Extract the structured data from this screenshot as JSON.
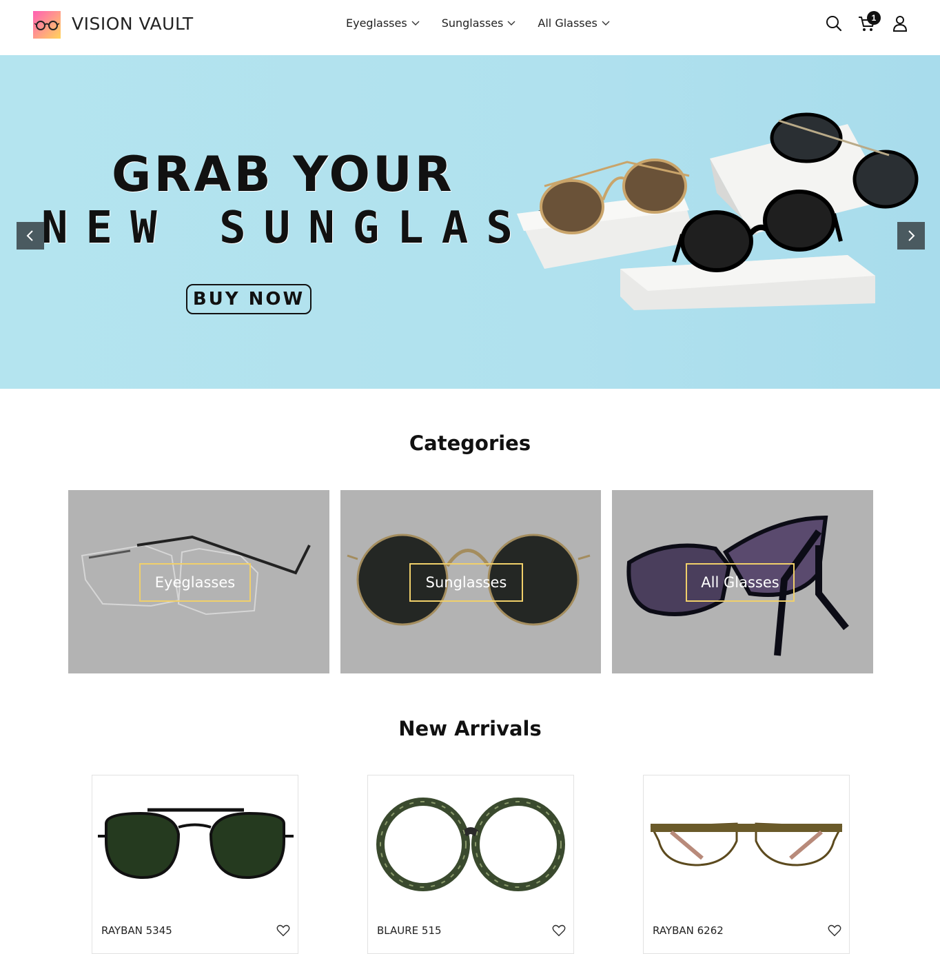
{
  "brand": {
    "name": "VISION VAULT",
    "logo_icon": "glasses-icon"
  },
  "nav": {
    "items": [
      {
        "label": "Eyeglasses",
        "icon": "chevron-down-icon"
      },
      {
        "label": "Sunglasses",
        "icon": "chevron-down-icon"
      },
      {
        "label": "All Glasses",
        "icon": "chevron-down-icon"
      }
    ]
  },
  "header_actions": {
    "search_icon": "search-icon",
    "cart_icon": "cart-icon",
    "cart_count": "1",
    "account_icon": "user-icon"
  },
  "hero": {
    "line1": "GRAB YOUR",
    "line2": "NEW SUNGLASSES",
    "cta": "BUY NOW",
    "prev_icon": "chevron-left-icon",
    "next_icon": "chevron-right-icon",
    "bg_color": "#b3e2ee"
  },
  "categories": {
    "title": "Categories",
    "items": [
      {
        "label": "Eyeglasses"
      },
      {
        "label": "Sunglasses"
      },
      {
        "label": "All Glasses"
      }
    ],
    "label_border_color": "#f1d06a"
  },
  "new_arrivals": {
    "title": "New Arrivals",
    "products": [
      {
        "name": "RAYBAN 5345",
        "icon": "heart-icon"
      },
      {
        "name": "BLAURE 515",
        "icon": "heart-icon"
      },
      {
        "name": "RAYBAN 6262",
        "icon": "heart-icon"
      }
    ]
  }
}
